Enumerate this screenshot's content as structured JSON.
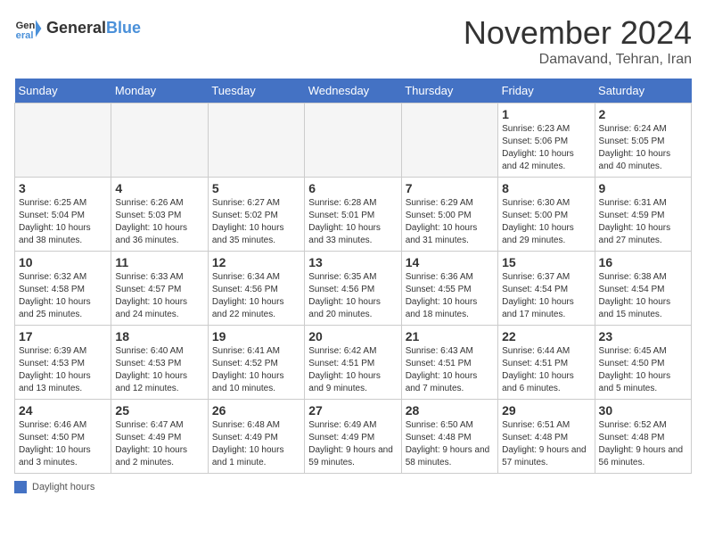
{
  "header": {
    "logo_line1": "General",
    "logo_line2": "Blue",
    "month": "November 2024",
    "location": "Damavand, Tehran, Iran"
  },
  "days_of_week": [
    "Sunday",
    "Monday",
    "Tuesday",
    "Wednesday",
    "Thursday",
    "Friday",
    "Saturday"
  ],
  "weeks": [
    [
      {
        "day": "",
        "info": ""
      },
      {
        "day": "",
        "info": ""
      },
      {
        "day": "",
        "info": ""
      },
      {
        "day": "",
        "info": ""
      },
      {
        "day": "",
        "info": ""
      },
      {
        "day": "1",
        "info": "Sunrise: 6:23 AM\nSunset: 5:06 PM\nDaylight: 10 hours and 42 minutes."
      },
      {
        "day": "2",
        "info": "Sunrise: 6:24 AM\nSunset: 5:05 PM\nDaylight: 10 hours and 40 minutes."
      }
    ],
    [
      {
        "day": "3",
        "info": "Sunrise: 6:25 AM\nSunset: 5:04 PM\nDaylight: 10 hours and 38 minutes."
      },
      {
        "day": "4",
        "info": "Sunrise: 6:26 AM\nSunset: 5:03 PM\nDaylight: 10 hours and 36 minutes."
      },
      {
        "day": "5",
        "info": "Sunrise: 6:27 AM\nSunset: 5:02 PM\nDaylight: 10 hours and 35 minutes."
      },
      {
        "day": "6",
        "info": "Sunrise: 6:28 AM\nSunset: 5:01 PM\nDaylight: 10 hours and 33 minutes."
      },
      {
        "day": "7",
        "info": "Sunrise: 6:29 AM\nSunset: 5:00 PM\nDaylight: 10 hours and 31 minutes."
      },
      {
        "day": "8",
        "info": "Sunrise: 6:30 AM\nSunset: 5:00 PM\nDaylight: 10 hours and 29 minutes."
      },
      {
        "day": "9",
        "info": "Sunrise: 6:31 AM\nSunset: 4:59 PM\nDaylight: 10 hours and 27 minutes."
      }
    ],
    [
      {
        "day": "10",
        "info": "Sunrise: 6:32 AM\nSunset: 4:58 PM\nDaylight: 10 hours and 25 minutes."
      },
      {
        "day": "11",
        "info": "Sunrise: 6:33 AM\nSunset: 4:57 PM\nDaylight: 10 hours and 24 minutes."
      },
      {
        "day": "12",
        "info": "Sunrise: 6:34 AM\nSunset: 4:56 PM\nDaylight: 10 hours and 22 minutes."
      },
      {
        "day": "13",
        "info": "Sunrise: 6:35 AM\nSunset: 4:56 PM\nDaylight: 10 hours and 20 minutes."
      },
      {
        "day": "14",
        "info": "Sunrise: 6:36 AM\nSunset: 4:55 PM\nDaylight: 10 hours and 18 minutes."
      },
      {
        "day": "15",
        "info": "Sunrise: 6:37 AM\nSunset: 4:54 PM\nDaylight: 10 hours and 17 minutes."
      },
      {
        "day": "16",
        "info": "Sunrise: 6:38 AM\nSunset: 4:54 PM\nDaylight: 10 hours and 15 minutes."
      }
    ],
    [
      {
        "day": "17",
        "info": "Sunrise: 6:39 AM\nSunset: 4:53 PM\nDaylight: 10 hours and 13 minutes."
      },
      {
        "day": "18",
        "info": "Sunrise: 6:40 AM\nSunset: 4:53 PM\nDaylight: 10 hours and 12 minutes."
      },
      {
        "day": "19",
        "info": "Sunrise: 6:41 AM\nSunset: 4:52 PM\nDaylight: 10 hours and 10 minutes."
      },
      {
        "day": "20",
        "info": "Sunrise: 6:42 AM\nSunset: 4:51 PM\nDaylight: 10 hours and 9 minutes."
      },
      {
        "day": "21",
        "info": "Sunrise: 6:43 AM\nSunset: 4:51 PM\nDaylight: 10 hours and 7 minutes."
      },
      {
        "day": "22",
        "info": "Sunrise: 6:44 AM\nSunset: 4:51 PM\nDaylight: 10 hours and 6 minutes."
      },
      {
        "day": "23",
        "info": "Sunrise: 6:45 AM\nSunset: 4:50 PM\nDaylight: 10 hours and 5 minutes."
      }
    ],
    [
      {
        "day": "24",
        "info": "Sunrise: 6:46 AM\nSunset: 4:50 PM\nDaylight: 10 hours and 3 minutes."
      },
      {
        "day": "25",
        "info": "Sunrise: 6:47 AM\nSunset: 4:49 PM\nDaylight: 10 hours and 2 minutes."
      },
      {
        "day": "26",
        "info": "Sunrise: 6:48 AM\nSunset: 4:49 PM\nDaylight: 10 hours and 1 minute."
      },
      {
        "day": "27",
        "info": "Sunrise: 6:49 AM\nSunset: 4:49 PM\nDaylight: 9 hours and 59 minutes."
      },
      {
        "day": "28",
        "info": "Sunrise: 6:50 AM\nSunset: 4:48 PM\nDaylight: 9 hours and 58 minutes."
      },
      {
        "day": "29",
        "info": "Sunrise: 6:51 AM\nSunset: 4:48 PM\nDaylight: 9 hours and 57 minutes."
      },
      {
        "day": "30",
        "info": "Sunrise: 6:52 AM\nSunset: 4:48 PM\nDaylight: 9 hours and 56 minutes."
      }
    ]
  ],
  "footer": {
    "label": "Daylight hours"
  }
}
